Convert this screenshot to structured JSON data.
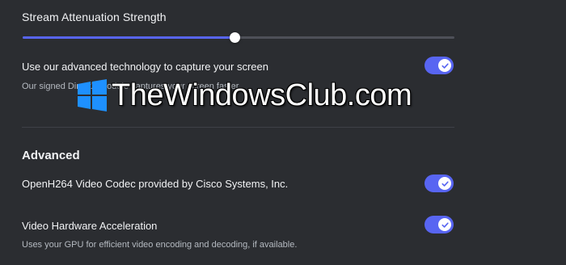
{
  "slider": {
    "title": "Stream Attenuation Strength",
    "value_fraction": 0.49
  },
  "settings": [
    {
      "label": "Use our advanced technology to capture your screen",
      "description": "Our signed DirectX module captures your screen faster.",
      "enabled": true
    },
    {
      "label": "OpenH264 Video Codec provided by Cisco Systems, Inc.",
      "enabled": true
    },
    {
      "label": "Video Hardware Acceleration",
      "description": "Uses your GPU for efficient video encoding and decoding, if available.",
      "enabled": true
    }
  ],
  "advanced": {
    "heading": "Advanced"
  },
  "watermark": {
    "text": "TheWindowsClub.com",
    "logo_icon": "windows-logo"
  },
  "colors": {
    "accent": "#5865f2",
    "background": "#2b2d31",
    "track": "#4e5058"
  }
}
